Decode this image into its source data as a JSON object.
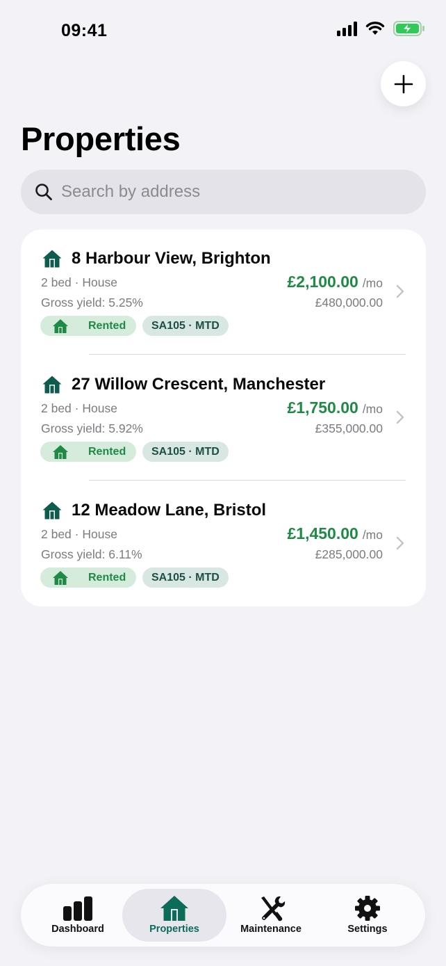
{
  "status_bar": {
    "time": "09:41"
  },
  "header": {
    "title": "Properties"
  },
  "search": {
    "placeholder": "Search by address",
    "value": ""
  },
  "colors": {
    "accent": "#0d6b5a",
    "rent": "#1e8a45",
    "tag_rented_bg": "#d5ebdb",
    "tag_tax_bg": "#d9e7e2"
  },
  "properties": [
    {
      "address": "8 Harbour View, Brighton",
      "meta": "2 bed · House",
      "yield": "Gross yield: 5.25%",
      "rent": "£2,100.00",
      "rent_period": "/mo",
      "value": "£480,000.00",
      "status": "Rented",
      "tax_tag": "SA105 · MTD"
    },
    {
      "address": "27 Willow Crescent, Manchester",
      "meta": "2 bed · House",
      "yield": "Gross yield: 5.92%",
      "rent": "£1,750.00",
      "rent_period": "/mo",
      "value": "£355,000.00",
      "status": "Rented",
      "tax_tag": "SA105 · MTD"
    },
    {
      "address": "12 Meadow Lane, Bristol",
      "meta": "2 bed · House",
      "yield": "Gross yield: 6.11%",
      "rent": "£1,450.00",
      "rent_period": "/mo",
      "value": "£285,000.00",
      "status": "Rented",
      "tax_tag": "SA105 · MTD"
    }
  ],
  "tab_bar": {
    "tabs": [
      {
        "label": "Dashboard",
        "icon": "bar-chart-icon"
      },
      {
        "label": "Properties",
        "icon": "house-icon",
        "active": true
      },
      {
        "label": "Maintenance",
        "icon": "wrench-screwdriver-icon"
      },
      {
        "label": "Settings",
        "icon": "gear-icon"
      }
    ]
  }
}
